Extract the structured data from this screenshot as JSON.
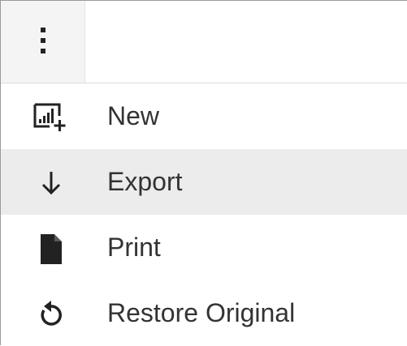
{
  "toolbar": {
    "more_button_icon": "more-vertical-icon"
  },
  "colors": {
    "icon": "#222222",
    "text": "#333333",
    "hover_row": "#ececec",
    "button_bg": "#f4f4f4"
  },
  "menu": {
    "items": [
      {
        "label": "New",
        "icon": "new-chart-icon",
        "highlighted": false
      },
      {
        "label": "Export",
        "icon": "arrow-down-icon",
        "highlighted": true
      },
      {
        "label": "Print",
        "icon": "document-icon",
        "highlighted": false
      },
      {
        "label": "Restore Original",
        "icon": "restore-icon",
        "highlighted": false
      }
    ]
  }
}
